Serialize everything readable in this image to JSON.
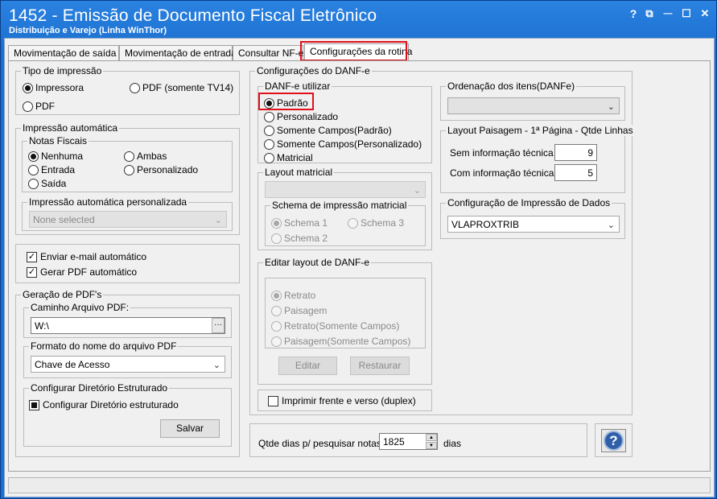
{
  "window": {
    "title": "1452 - Emissão de Documento Fiscal Eletrônico",
    "subtitle": "Distribuição e Varejo (Linha WinThor)",
    "help_btn": "?",
    "restore_btn": "⧉",
    "minimize_btn": "—",
    "maximize_btn": "☐",
    "close_btn": "✕"
  },
  "tabs": [
    {
      "label": "Movimentação de saída"
    },
    {
      "label": "Movimentação de entrada"
    },
    {
      "label": "Consultar NF-e"
    },
    {
      "label": "Configurações da rotina",
      "active": true
    }
  ],
  "tipo_impressao": {
    "title": "Tipo de impressão",
    "impressora": "Impressora",
    "pdf_tv14": "PDF (somente TV14)",
    "pdf": "PDF",
    "selected": "Impressora"
  },
  "impressao_automatica": {
    "title": "Impressão automática",
    "notas_title": "Notas Fiscais",
    "nenhuma": "Nenhuma",
    "ambas": "Ambas",
    "entrada": "Entrada",
    "personalizado": "Personalizado",
    "saida": "Saída",
    "selected": "Nenhuma",
    "personalizada_title": "Impressão automática personalizada",
    "personalizada_value": "None selected"
  },
  "envio": {
    "email": "Enviar e-mail automático",
    "email_checked": true,
    "pdf": "Gerar PDF automático",
    "pdf_checked": true,
    "check_glyph": "✓"
  },
  "geracao_pdf": {
    "title": "Geração de PDF's",
    "caminho_title": "Caminho Arquivo PDF:",
    "caminho_value": "W:\\",
    "browse_label": "···",
    "formato_title": "Formato do nome do arquivo PDF",
    "formato_value": "Chave de Acesso",
    "diretorio_title": "Configurar Diretório Estruturado",
    "diretorio_check": "Configurar Diretório estruturado",
    "salvar": "Salvar"
  },
  "danfe": {
    "title": "Configurações do DANF-e",
    "utilizar_title": "DANF-e utilizar",
    "options": [
      "Padrão",
      "Personalizado",
      "Somente Campos(Padrão)",
      "Somente Campos(Personalizado)",
      "Matricial"
    ],
    "selected": "Padrão",
    "layout_matricial_title": "Layout matricial",
    "schema_title": "Schema de impressão matricial",
    "schema1": "Schema 1",
    "schema2": "Schema 2",
    "schema3": "Schema 3",
    "editar_layout_title": "Editar layout de DANF-e",
    "layout_options": [
      "Retrato",
      "Paisagem",
      "Retrato(Somente Campos)",
      "Paisagem(Somente Campos)"
    ],
    "editar": "Editar",
    "restaurar": "Restaurar",
    "duplex": "Imprimir frente e verso (duplex)"
  },
  "ordenacao": {
    "title": "Ordenação dos itens(DANFe)",
    "value": ""
  },
  "layout_paisagem": {
    "title": "Layout Paisagem - 1ª Página - Qtde Linhas",
    "sem_info": "Sem informação técnica",
    "sem_info_value": "9",
    "com_info": "Com informação técnica",
    "com_info_value": "5"
  },
  "config_impressao_dados": {
    "title": "Configuração de Impressão de Dados",
    "value": "VLAPROXTRIB"
  },
  "qtde_dias": {
    "label": "Qtde dias p/ pesquisar notas:",
    "value": "1825",
    "unit": "dias",
    "up": "▲",
    "down": "▼"
  },
  "help_button": "?",
  "chevron": "⌄",
  "colors": {
    "title_bar": "#1c6fd0",
    "highlight": "#e0101a",
    "help_blue": "#2f5fa8"
  }
}
